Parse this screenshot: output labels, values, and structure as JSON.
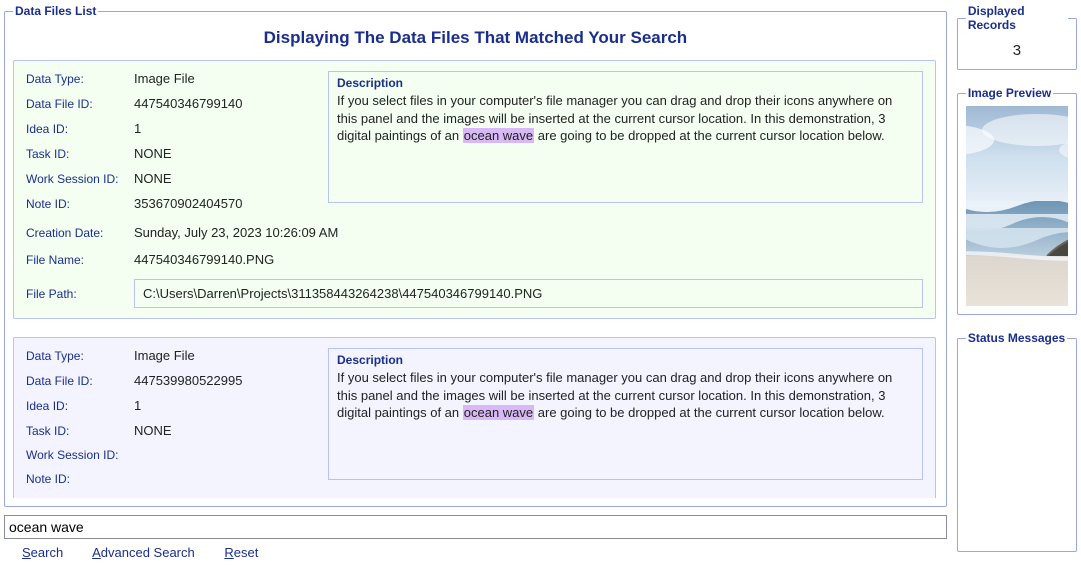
{
  "panels": {
    "data_files_list": "Data Files List",
    "displayed_records": "Displayed Records",
    "image_preview": "Image Preview",
    "status_messages": "Status Messages"
  },
  "list_title": "Displaying The Data Files That Matched Your Search",
  "displayed_count": "3",
  "labels": {
    "data_type": "Data Type:",
    "data_file_id": "Data File ID:",
    "idea_id": "Idea ID:",
    "task_id": "Task ID:",
    "work_session_id": "Work Session ID:",
    "note_id": "Note ID:",
    "creation_date": "Creation Date:",
    "file_name": "File Name:",
    "file_path": "File Path:",
    "description": "Description"
  },
  "records": [
    {
      "data_type": "Image File",
      "data_file_id": "447540346799140",
      "idea_id": "1",
      "task_id": "NONE",
      "work_session_id": "NONE",
      "note_id": "353670902404570",
      "creation_date": "Sunday, July 23, 2023   10:26:09 AM",
      "file_name": "447540346799140.PNG",
      "file_path": "C:\\Users\\Darren\\Projects\\311358443264238\\447540346799140.PNG",
      "description_pre": "If you select files in your computer's file manager you can drag and drop their icons anywhere on this panel and the images will be inserted at the current cursor location. In this demonstration, 3 digital paintings of an ",
      "description_hl": "ocean wave",
      "description_post": " are going to be dropped at the current cursor location below."
    },
    {
      "data_type": "Image File",
      "data_file_id": "447539980522995",
      "idea_id": "1",
      "task_id": "NONE",
      "work_session_id": "",
      "note_id": "",
      "creation_date": "",
      "file_name": "",
      "file_path": "",
      "description_pre": "If you select files in your computer's file manager you can drag and drop their icons anywhere on this panel and the images will be inserted at the current cursor location. In this demonstration, 3 digital paintings of an ",
      "description_hl": "ocean wave",
      "description_post": " are going to be dropped at the current cursor location below."
    }
  ],
  "search": {
    "value": "ocean wave",
    "search_label": "Search",
    "advanced_label": "Advanced Search",
    "reset_label": "Reset"
  },
  "status_text": ""
}
